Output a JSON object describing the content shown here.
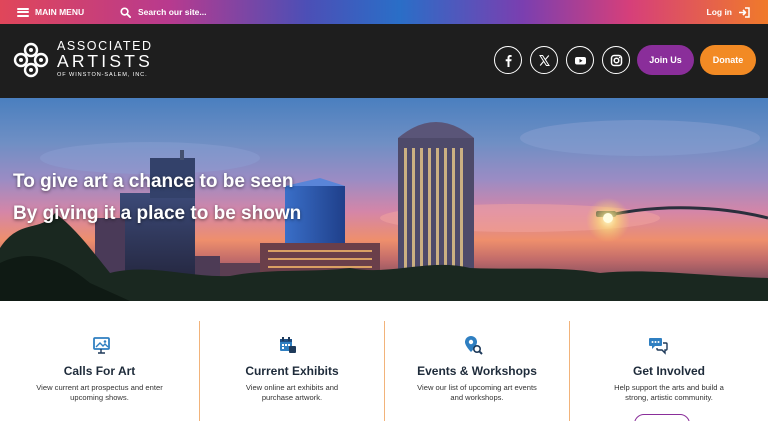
{
  "topbar": {
    "menu_label": "MAIN MENU",
    "search_placeholder": "Search our site...",
    "login_label": "Log in"
  },
  "logo": {
    "line1": "ASSOCIATED",
    "line2": "ARTISTS",
    "line3": "OF WINSTON-SALEM, INC."
  },
  "social": [
    "facebook-icon",
    "x-icon",
    "youtube-icon",
    "instagram-icon"
  ],
  "buttons": {
    "join": "Join Us",
    "donate": "Donate"
  },
  "hero": {
    "line1": "To give art a chance to be seen",
    "line2": "By giving it a place to be shown"
  },
  "features": [
    {
      "icon": "art-gallery-icon",
      "title": "Calls For Art",
      "desc": "View current art prospectus and enter upcoming shows."
    },
    {
      "icon": "calendar-icon",
      "title": "Current Exhibits",
      "desc": "View online art exhibits and purchase artwork."
    },
    {
      "icon": "location-search-icon",
      "title": "Events & Workshops",
      "desc": "View our list of upcoming art events and workshops."
    },
    {
      "icon": "chat-icon",
      "title": "Get Involved",
      "desc": "Help support the arts and build a strong, artistic community."
    }
  ],
  "colors": {
    "accent_blue": "#2f7fc1",
    "purple": "#8a2e9a",
    "orange": "#f28a24",
    "header_bg": "#1e1e1e"
  }
}
